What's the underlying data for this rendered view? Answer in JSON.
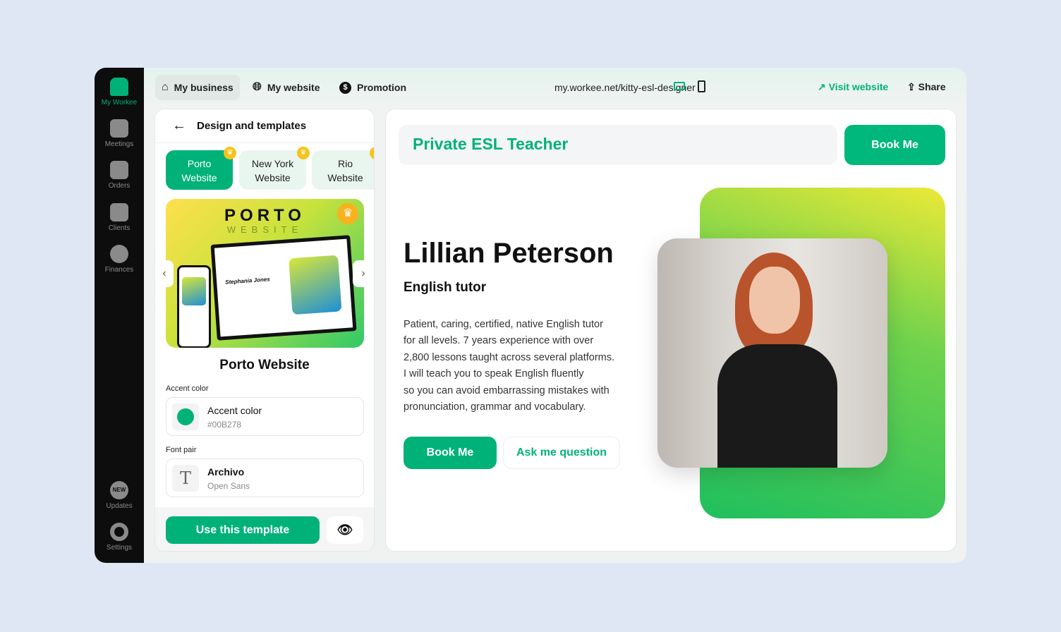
{
  "sidebar": {
    "items": [
      {
        "label": "My Workee",
        "icon": "workee-logo-icon"
      },
      {
        "label": "Meetings",
        "icon": "calendar-icon"
      },
      {
        "label": "Orders",
        "icon": "orders-icon"
      },
      {
        "label": "Clients",
        "icon": "user-icon"
      },
      {
        "label": "Finances",
        "icon": "dollar-icon"
      },
      {
        "label": "Updates",
        "icon": "new-badge-icon"
      },
      {
        "label": "Settings",
        "icon": "gear-icon"
      }
    ]
  },
  "topbar": {
    "nav": [
      {
        "label": "My business"
      },
      {
        "label": "My website"
      },
      {
        "label": "Promotion"
      }
    ],
    "url": "my.workee.net/kitty-esl-designer",
    "visit": "Visit website",
    "share": "Share"
  },
  "left": {
    "title": "Design and templates",
    "tabs": [
      {
        "label1": "Porto",
        "label2": "Website"
      },
      {
        "label1": "New York",
        "label2": "Website"
      },
      {
        "label1": "Rio",
        "label2": "Website"
      }
    ],
    "preview": {
      "brand1": "PORTO",
      "brand2": "WEBSITE",
      "mock_name": "Stephania Jones"
    },
    "template_name": "Porto Website",
    "accent_label": "Accent color",
    "accent_title": "Accent color",
    "accent_value": "#00B278",
    "font_label": "Font pair",
    "font_primary": "Archivo",
    "font_secondary": "Open Sans",
    "use_button": "Use this template"
  },
  "site": {
    "header_title": "Private ESL Teacher",
    "header_button": "Book Me",
    "name": "Lillian Peterson",
    "role": "English tutor",
    "bio": [
      "Patient, caring, certified, native English tutor",
      "for all levels. 7 years experience with over",
      "2,800 lessons taught across several platforms.",
      "I will teach you to speak English fluently",
      "so you can avoid embarrassing mistakes with",
      "pronunciation, grammar and vocabulary."
    ],
    "book_button": "Book Me",
    "ask_button": "Ask me question"
  },
  "colors": {
    "accent": "#00B278"
  }
}
